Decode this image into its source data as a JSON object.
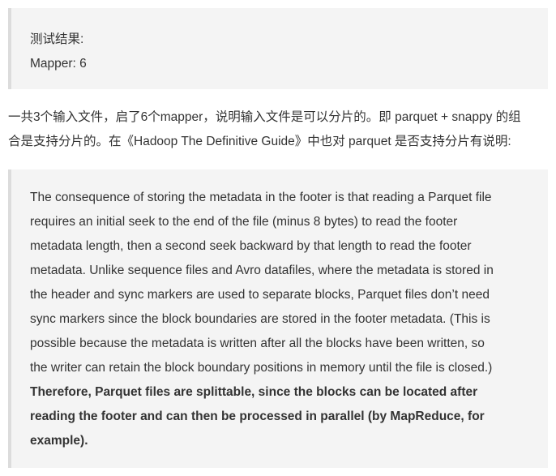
{
  "test_block": {
    "heading": "测试结果:",
    "result": "Mapper: 6"
  },
  "paragraph": {
    "line1": "一共3个输入文件，启了6个mapper，说明输入文件是可以分片的。即 parquet + snappy 的组",
    "line2": "合是支持分片的。在《Hadoop The Definitive Guide》中也对 parquet 是否支持分片有说明:"
  },
  "quote": {
    "lines": [
      "The consequence of storing the metadata in the footer is that reading a Parquet file",
      "requires an initial seek to the end of the file (minus 8 bytes) to read the footer",
      "metadata length, then a second seek backward by that length to read the footer",
      "metadata. Unlike sequence files and Avro datafiles, where the metadata is stored in",
      "the header and sync markers are used to separate blocks, Parquet files don’t need",
      "sync markers since the block boundaries are stored in the footer metadata. (This is",
      "possible because the metadata is written after all the blocks have been written, so",
      "the writer can retain the block boundary positions in memory until the file is closed.)"
    ],
    "bold_lines": [
      "Therefore, Parquet files are splittable, since the blocks can be located after",
      "reading the footer and can then be processed in parallel (by MapReduce, for",
      "example)."
    ]
  }
}
